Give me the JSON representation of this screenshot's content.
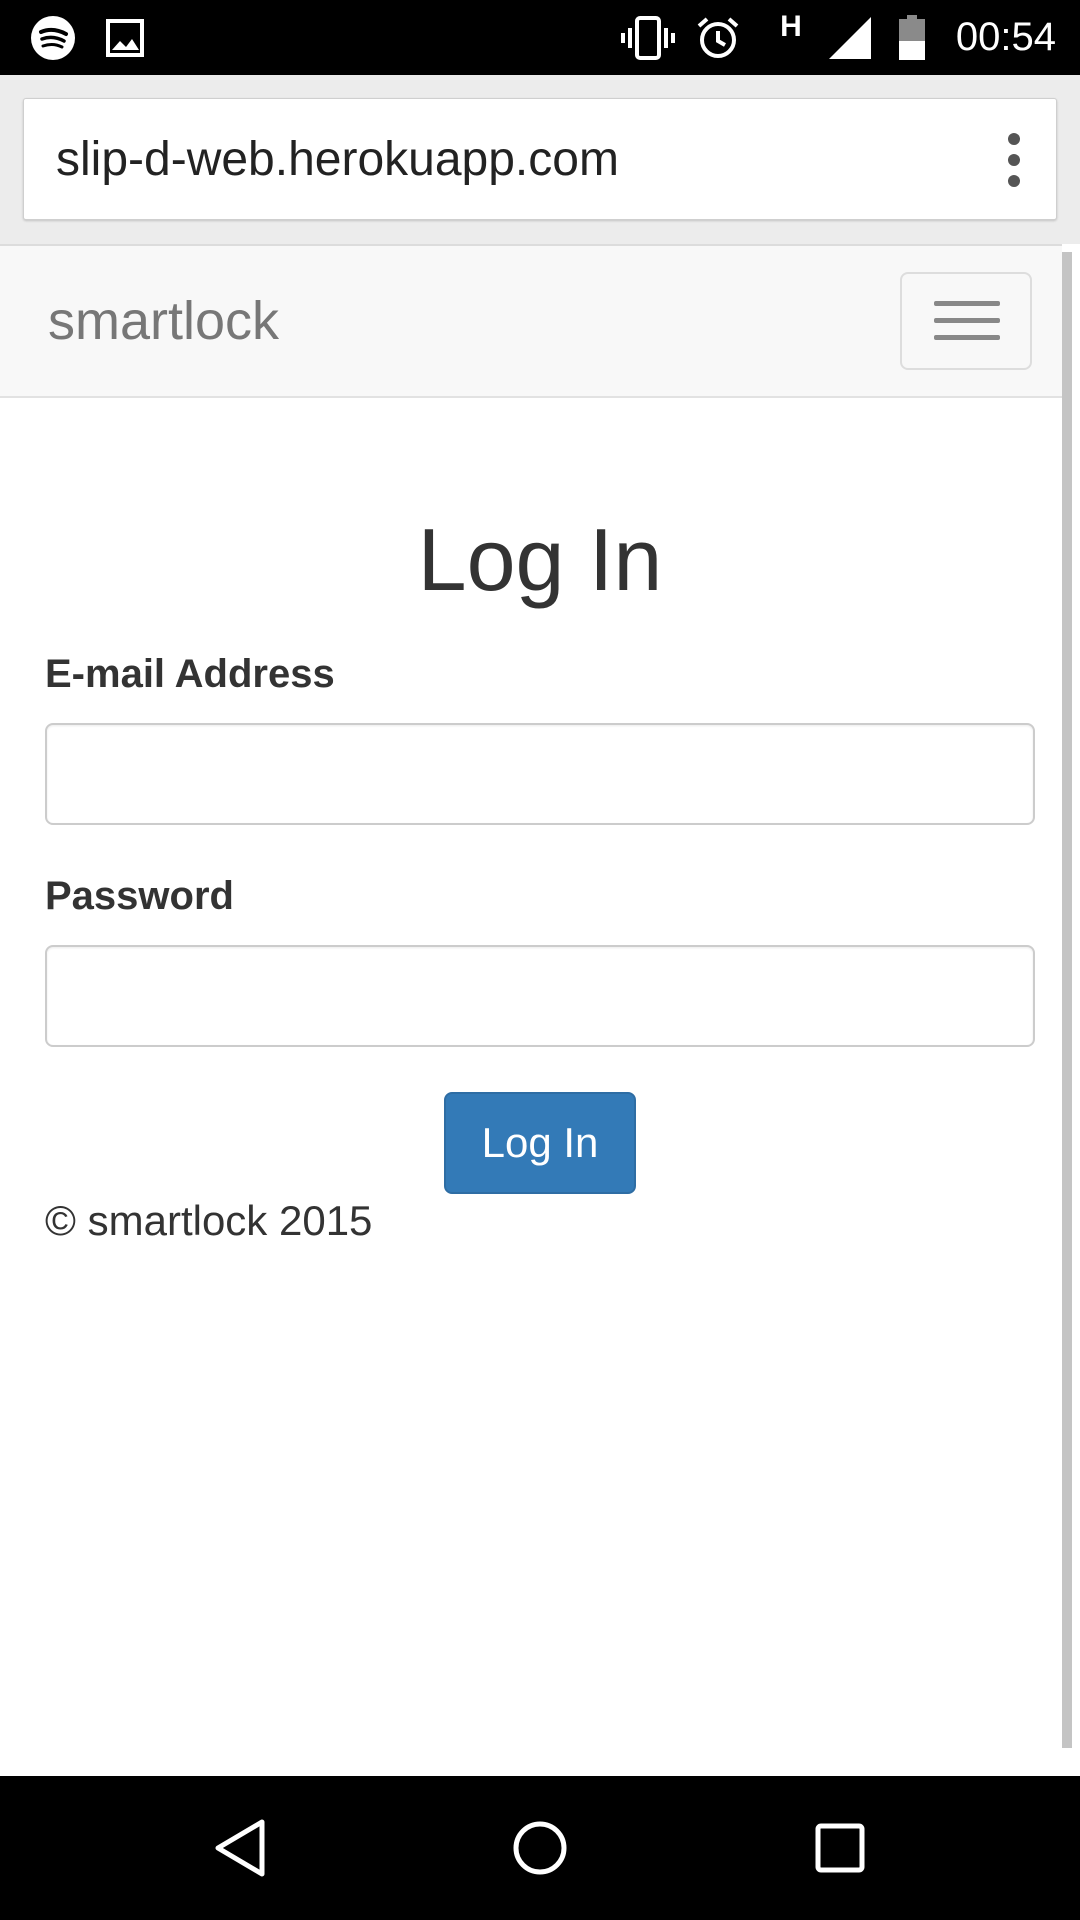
{
  "status_bar": {
    "time": "00:54",
    "network_type": "H",
    "left_icons": [
      "spotify-icon",
      "image-icon"
    ],
    "right_icons": [
      "vibrate-icon",
      "alarm-icon",
      "signal-icon",
      "battery-icon"
    ]
  },
  "browser": {
    "url": "slip-d-web.herokuapp.com",
    "menu_icon": "overflow-menu-icon"
  },
  "navbar": {
    "brand": "smartlock",
    "toggle_icon": "hamburger-icon"
  },
  "login_form": {
    "title": "Log In",
    "email_label": "E-mail Address",
    "email_value": "",
    "password_label": "Password",
    "password_value": "",
    "submit_label": "Log In"
  },
  "footer": {
    "text": "© smartlock 2015"
  },
  "android_nav": {
    "buttons": [
      "back-icon",
      "home-icon",
      "recents-icon"
    ]
  },
  "colors": {
    "primary_button": "#337ab7",
    "navbar_bg": "#f8f8f8",
    "brand_text": "#777777"
  }
}
